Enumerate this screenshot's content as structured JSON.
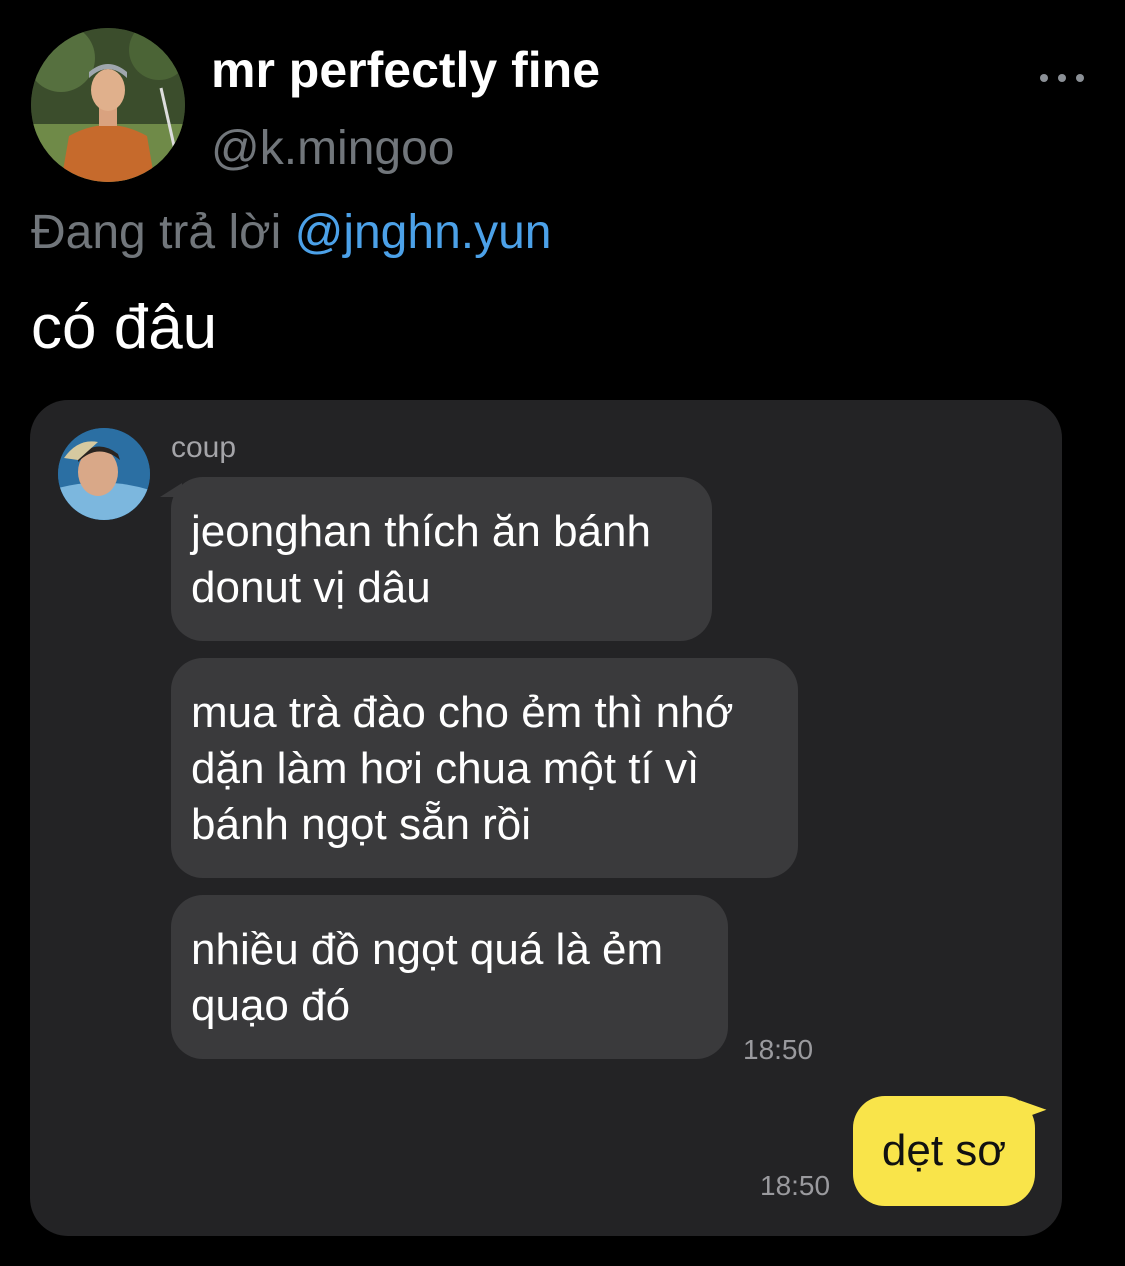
{
  "tweet": {
    "display_name": "mr perfectly fine",
    "handle": "@k.mingoo",
    "reply_prefix": "Đang trả lời",
    "reply_mention": "@jnghn.yun",
    "text": "có đâu",
    "more_icon": "more-horizontal-icon"
  },
  "chat": {
    "sender_name": "coup",
    "messages": [
      {
        "text": "jeonghan thích ăn bánh donut vị dâu"
      },
      {
        "text": "mua trà đào cho ẻm thì nhớ dặn làm hơi chua một tí vì bánh ngọt sẵn rồi"
      },
      {
        "text": "nhiều đồ ngọt quá là ẻm quạo đó",
        "time": "18:50"
      }
    ],
    "my_message": {
      "text": "dẹt sơ",
      "time": "18:50"
    }
  },
  "colors": {
    "background": "#000000",
    "secondary_text": "#71767b",
    "mention": "#4ca1e8",
    "chat_background": "#232325",
    "incoming_bubble": "#3a3a3c",
    "outgoing_bubble": "#f9e44a"
  }
}
